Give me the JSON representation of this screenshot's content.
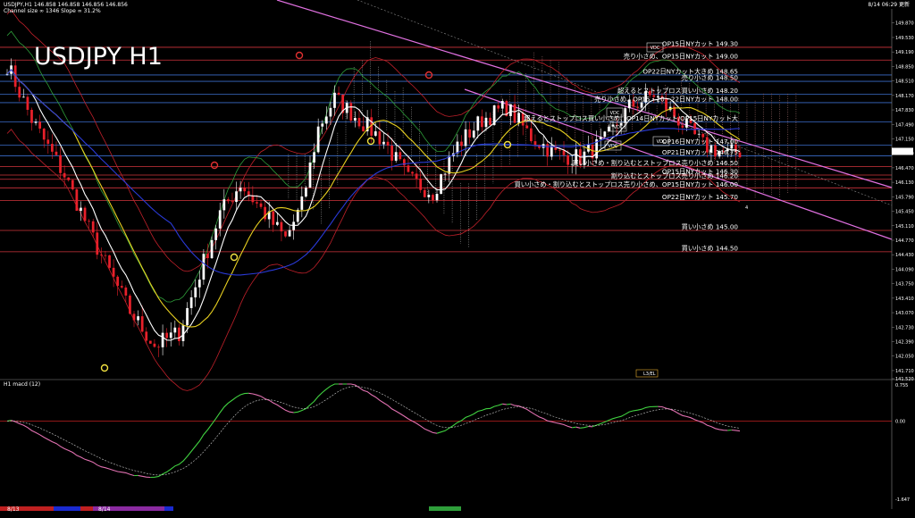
{
  "header": {
    "left_line1": "USDJPY,H1  146.858 146.858 146.856 146.856",
    "left_line2": "Channel size ∞ 1346 Slope ∞ 31.2%",
    "right_time": "8/14 06:29 更新"
  },
  "chart_title": "USDJPY H1",
  "chart_data": {
    "type": "line",
    "title": "USDJPY H1",
    "price_axis": {
      "ylim": [
        141.52,
        150.2
      ],
      "tick_labels": [
        "149.870",
        "149.530",
        "149.190",
        "148.850",
        "148.510",
        "148.170",
        "147.830",
        "147.490",
        "147.150",
        "146.810",
        "146.470",
        "146.130",
        "145.790",
        "145.450",
        "145.110",
        "144.770",
        "144.430",
        "144.090",
        "143.750",
        "143.410",
        "143.070",
        "142.730",
        "142.390",
        "142.050",
        "141.710",
        "141.520"
      ],
      "current_price": "146.856"
    },
    "levels": [
      {
        "label": "OP15日NYカット 149.30",
        "price": 149.3,
        "color": "#d0343c"
      },
      {
        "label": "売り小さめ、OP15日NYカット 149.00",
        "price": 149.0,
        "color": "#d0343c"
      },
      {
        "label": "OP22日NYカット大きめ 148.65",
        "price": 148.65,
        "color": "#3a6cc8"
      },
      {
        "label": "売り小さめ 148.50",
        "price": 148.5,
        "color": "#3a6cc8"
      },
      {
        "label": "超えるとストップロス買い小さめ 148.20",
        "price": 148.2,
        "color": "#3a6cc8"
      },
      {
        "label": "売り小さめ、OP15・20・22日NYカット 148.00",
        "price": 148.0,
        "color": "#3a6cc8"
      },
      {
        "label": "超えるとストップロス買い小さめ、OP14日NYカット/OP15日NYカット大",
        "price": 147.55,
        "color": "#3a6cc8"
      },
      {
        "label": "OP16日NYカット 147.00",
        "price": 147.0,
        "color": "#3a6cc8"
      },
      {
        "label": "OP21日NYカット 146.75",
        "price": 146.75,
        "color": "#3a6cc8"
      },
      {
        "label": "買い小さめ・割り込むとストップロス売り小さめ 146.50",
        "price": 146.5,
        "color": "#d0343c"
      },
      {
        "label": "OP15日NYカット 146.30",
        "price": 146.3,
        "color": "#d0343c"
      },
      {
        "label": "割り込むとストップロス売り小さめ 146.20",
        "price": 146.2,
        "color": "#d0343c"
      },
      {
        "label": "買い小さめ・割り込むとストップロス売り小さめ、OP15日NYカット 146.00",
        "price": 146.0,
        "color": "#d0343c"
      },
      {
        "label": "OP22日NYカット 145.70",
        "price": 145.7,
        "color": "#d0343c"
      },
      {
        "label": "買い小さめ 145.00",
        "price": 145.0,
        "color": "#d0343c"
      },
      {
        "label": "買い小さめ 144.50",
        "price": 144.5,
        "color": "#d0343c"
      }
    ],
    "indicator": {
      "name": "H1 macd (12)",
      "top_label": "0.755",
      "zero_label": "0.00",
      "bottom_label": "-1.647"
    },
    "time_axis": {
      "labels": [
        "8/13",
        "8/14"
      ]
    },
    "markers": {
      "box_labels": [
        "VDC",
        "VDC",
        "VDC",
        "VDC",
        "VDC"
      ],
      "small_label": "4",
      "bottom_tag": "L3/EL"
    }
  }
}
